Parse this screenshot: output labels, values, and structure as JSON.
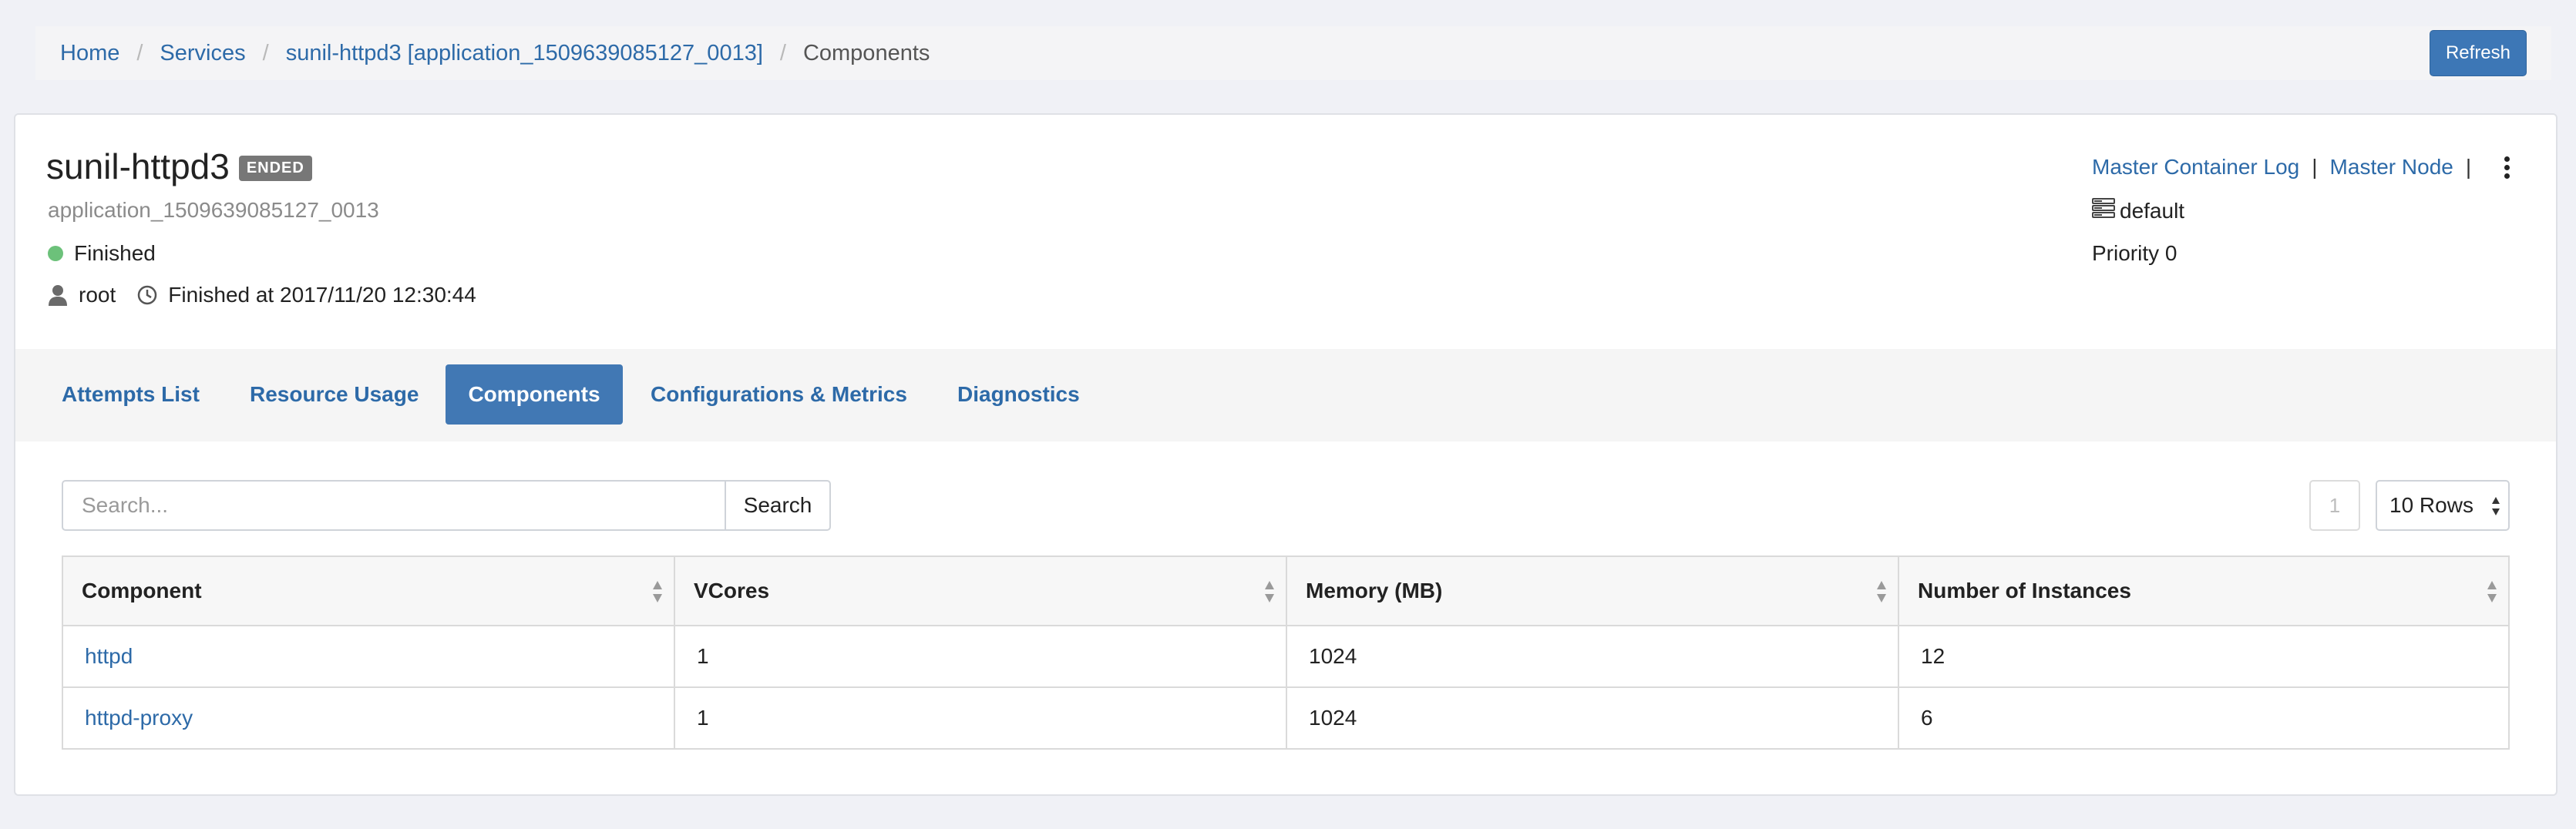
{
  "breadcrumb": {
    "items": [
      "Home",
      "Services",
      "sunil-httpd3 [application_1509639085127_0013]"
    ],
    "current": "Components",
    "separator": "/"
  },
  "toolbar": {
    "refresh_label": "Refresh"
  },
  "app": {
    "name": "sunil-httpd3",
    "badge": "ENDED",
    "id": "application_1509639085127_0013",
    "status": "Finished",
    "user": "root",
    "finished_at": "Finished at 2017/11/20 12:30:44",
    "icons": {
      "user": "user-icon",
      "clock": "clock-icon",
      "queue": "queue-icon",
      "menu": "kebab-menu-icon"
    }
  },
  "right_info": {
    "master_log_label": "Master Container Log",
    "master_node_label": "Master Node",
    "pipe": "|",
    "queue": "default",
    "priority": "Priority 0"
  },
  "tabs": [
    {
      "label": "Attempts List",
      "active": false
    },
    {
      "label": "Resource Usage",
      "active": false
    },
    {
      "label": "Components",
      "active": true
    },
    {
      "label": "Configurations & Metrics",
      "active": false
    },
    {
      "label": "Diagnostics",
      "active": false
    }
  ],
  "search": {
    "placeholder": "Search...",
    "button_label": "Search"
  },
  "pagination": {
    "page": "1",
    "rows_label": "10 Rows"
  },
  "table": {
    "columns": [
      "Component",
      "VCores",
      "Memory (MB)",
      "Number of Instances"
    ],
    "rows": [
      {
        "component": "httpd",
        "vcores": "1",
        "memory": "1024",
        "instances": "12"
      },
      {
        "component": "httpd-proxy",
        "vcores": "1",
        "memory": "1024",
        "instances": "6"
      }
    ]
  },
  "colors": {
    "accent": "#3d77b6",
    "link": "#2d6aa8",
    "status_ok": "#6cc17a",
    "badge": "#777777"
  }
}
